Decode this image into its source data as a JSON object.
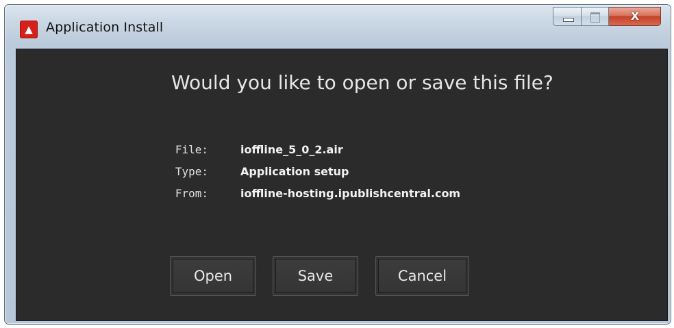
{
  "window": {
    "title": "Application Install",
    "icon": "adobe-air-icon",
    "close_glyph": "X"
  },
  "dialog": {
    "question": "Would you like to open or save this file?",
    "fields": [
      {
        "label": "File:",
        "value": "ioffline_5_0_2.air"
      },
      {
        "label": "Type:",
        "value": "Application setup"
      },
      {
        "label": "From:",
        "value": "ioffline-hosting.ipublishcentral.com"
      }
    ],
    "buttons": {
      "open": "Open",
      "save": "Save",
      "cancel": "Cancel"
    }
  },
  "colors": {
    "content_background": "#2b2b2b",
    "icon_red": "#d6211b"
  }
}
